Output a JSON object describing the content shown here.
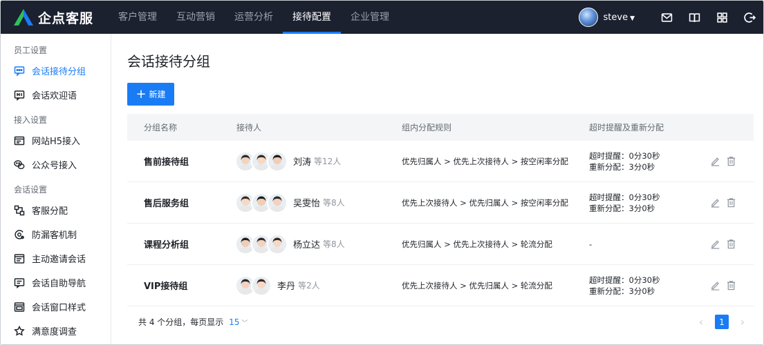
{
  "app": {
    "name": "企点客服"
  },
  "nav": {
    "items": [
      {
        "label": "客户管理"
      },
      {
        "label": "互动营销"
      },
      {
        "label": "运营分析"
      },
      {
        "label": "接待配置"
      },
      {
        "label": "企业管理"
      }
    ],
    "active_index": 3
  },
  "user": {
    "name": "steve"
  },
  "header_icons": [
    "mail-icon",
    "book-icon",
    "grid-icon",
    "logout-icon"
  ],
  "sidebar": {
    "sections": [
      {
        "title": "员工设置",
        "items": [
          {
            "label": "会话接待分组",
            "icon": "chat-group-icon",
            "active": true
          },
          {
            "label": "会话欢迎语",
            "icon": "hi-icon"
          }
        ]
      },
      {
        "title": "接入设置",
        "items": [
          {
            "label": "网站H5接入",
            "icon": "web-icon"
          },
          {
            "label": "公众号接入",
            "icon": "wechat-icon"
          }
        ]
      },
      {
        "title": "会话设置",
        "items": [
          {
            "label": "客服分配",
            "icon": "distribute-icon"
          },
          {
            "label": "防漏客机制",
            "icon": "guard-icon"
          },
          {
            "label": "主动邀请会话",
            "icon": "invite-icon"
          },
          {
            "label": "会话自助导航",
            "icon": "nav-icon"
          },
          {
            "label": "会话窗口样式",
            "icon": "window-icon"
          },
          {
            "label": "满意度调查",
            "icon": "survey-icon"
          }
        ]
      }
    ]
  },
  "main": {
    "title": "会话接待分组",
    "new_button": "新建",
    "table": {
      "headers": [
        "分组名称",
        "接待人",
        "组内分配规则",
        "超时提醒及重新分配"
      ],
      "rows": [
        {
          "name": "售前接待组",
          "agent": "刘涛",
          "count": "等12人",
          "faces": 3,
          "rule": "优先归属人 > 优先上次接待人 > 按空闲率分配",
          "timeout": "超时提醒：0分30秒",
          "reassign": "重新分配：3分0秒"
        },
        {
          "name": "售后服务组",
          "agent": "吴雯怡",
          "count": "等8人",
          "faces": 3,
          "rule": "优先上次接待人 > 优先归属人 > 按空闲率分配",
          "timeout": "超时提醒：0分30秒",
          "reassign": "重新分配：3分0秒"
        },
        {
          "name": "课程分析组",
          "agent": "杨立达",
          "count": "等8人",
          "faces": 3,
          "rule": "优先归属人 > 优先上次接待人 >  轮流分配",
          "timeout": "-",
          "reassign": ""
        },
        {
          "name": "VIP接待组",
          "agent": "李丹",
          "count": "等2人",
          "faces": 2,
          "rule": "优先上次接待人 > 优先归属人 > 轮流分配",
          "timeout": "超时提醒：0分30秒",
          "reassign": "重新分配：3分0秒"
        }
      ]
    },
    "footer": {
      "total": "共 4 个分组，每页显示",
      "page_size": "15",
      "current_page": "1"
    }
  },
  "colors": {
    "primary": "#1a7cf5",
    "topbar": "#1c2130"
  }
}
